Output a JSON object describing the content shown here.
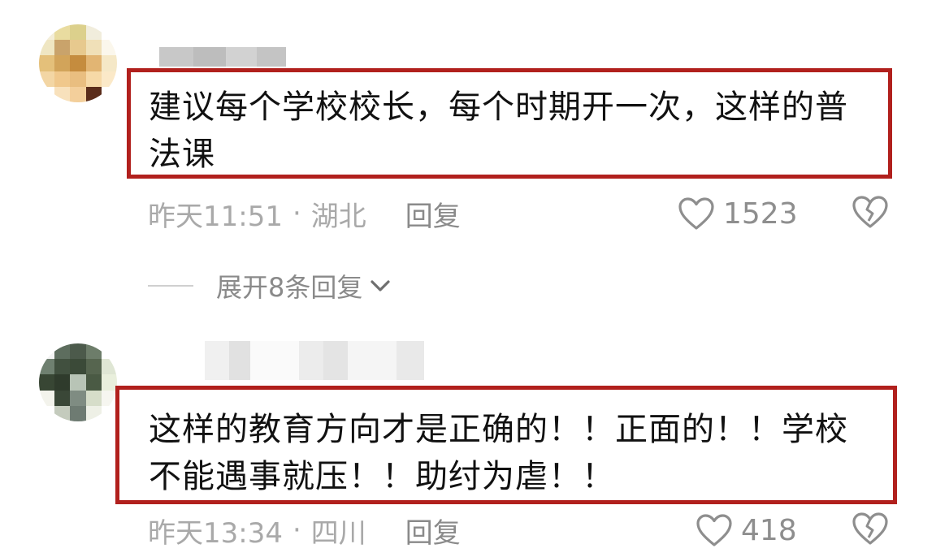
{
  "comments": [
    {
      "text": "建议每个学校校长，每个时期开一次，这样的普法课",
      "time": "昨天11:51",
      "location": "湖北",
      "reply_label": "回复",
      "likes": "1523",
      "expand_replies": "展开8条回复"
    },
    {
      "text": "这样的教育方向才是正确的！！正面的！！学校不能遇事就压！！助纣为虐！！",
      "time": "昨天13:34",
      "location": "四川",
      "reply_label": "回复",
      "likes": "418"
    }
  ],
  "icons": {
    "like": "heart-outline-icon",
    "dislike": "broken-heart-icon",
    "expand": "chevron-down-icon"
  },
  "colors": {
    "highlight_border": "#b1201d",
    "meta_text": "#a9a9a9"
  }
}
